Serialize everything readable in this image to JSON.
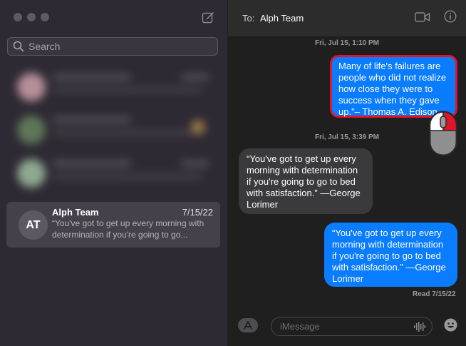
{
  "sidebar": {
    "search": {
      "placeholder": "Search"
    },
    "conversations": [
      {
        "initials": "AT",
        "name": "Alph Team",
        "date": "7/15/22",
        "preview": "“You've got to get up every morning with determination if you're going to go..."
      }
    ]
  },
  "chat": {
    "to_label": "To:",
    "recipient": "Alph Team",
    "messages": [
      {
        "timestamp": "Fri, Jul 15, 1:10 PM"
      },
      {
        "direction": "outgoing",
        "text": "Many of life's failures are people who did not realize how close they were to success when they gave up.\"– Thomas A. Edison"
      },
      {
        "timestamp": "Fri, Jul 15, 3:39 PM"
      },
      {
        "direction": "incoming",
        "text": "“You've got to get up every morning with determination if you're going to go to bed with satisfaction.” —George Lorimer"
      },
      {
        "direction": "outgoing",
        "text": "“You've got to get up every morning with determination if you're going to go to bed with satisfaction.” —George Lorimer"
      }
    ],
    "read_receipt": "Read 7/15/22",
    "input": {
      "placeholder": "iMessage"
    }
  },
  "colors": {
    "sidebar_bg": "#2e2a33",
    "selected_row": "#45414a",
    "outgoing_bubble": "#0a7cff",
    "incoming_bubble": "#3a3a3c",
    "highlight": "#e0142a"
  },
  "icons": [
    "compose-icon",
    "search-icon",
    "video-icon",
    "info-icon",
    "app-store-icon",
    "audio-wave-icon",
    "emoji-icon",
    "mouse-left-click-icon"
  ]
}
